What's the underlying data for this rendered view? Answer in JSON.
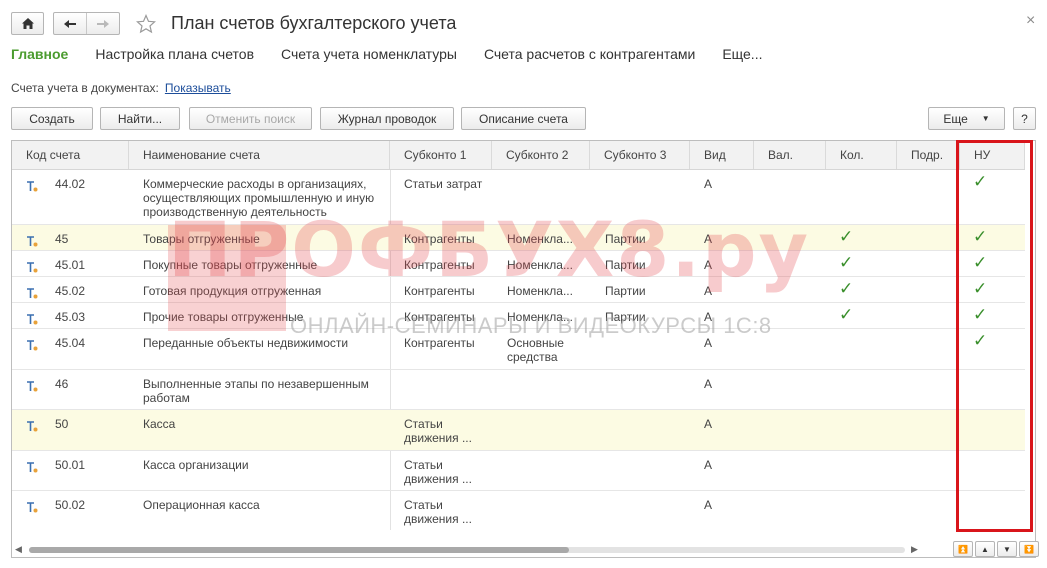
{
  "window": {
    "title": "План счетов бухгалтерского учета",
    "close_glyph": "×",
    "icons": [
      "home-icon",
      "back-arrow-icon",
      "forward-arrow-icon",
      "star-icon"
    ]
  },
  "tabs": [
    {
      "label": "Главное",
      "active": true
    },
    {
      "label": "Настройка плана счетов",
      "active": false
    },
    {
      "label": "Счета учета номенклатуры",
      "active": false
    },
    {
      "label": "Счета расчетов с контрагентами",
      "active": false
    },
    {
      "label": "Еще...",
      "active": false
    }
  ],
  "doc_accounts": {
    "label": "Счета учета в документах:",
    "link": "Показывать"
  },
  "toolbar": {
    "create": "Создать",
    "find": "Найти...",
    "cancel_search": "Отменить поиск",
    "journal": "Журнал проводок",
    "description": "Описание счета",
    "more": "Еще",
    "help": "?"
  },
  "columns": [
    "Код счета",
    "Наименование счета",
    "Субконто 1",
    "Субконто 2",
    "Субконто 3",
    "Вид",
    "Вал.",
    "Кол.",
    "Подр.",
    "НУ"
  ],
  "rows": [
    {
      "code": "44.02",
      "name": "Коммерческие расходы в организациях, осуществляющих промышленную и иную производственную деятельность",
      "s1": "Статьи затрат",
      "s2": "",
      "s3": "",
      "vid": "А",
      "kol": "",
      "nu": "✓"
    },
    {
      "code": "45",
      "name": "Товары отгруженные",
      "s1": "Контрагенты",
      "s2": "Номенкла...",
      "s3": "Партии",
      "vid": "А",
      "kol": "✓",
      "nu": "✓"
    },
    {
      "code": "45.01",
      "name": "Покупные товары отгруженные",
      "s1": "Контрагенты",
      "s2": "Номенкла...",
      "s3": "Партии",
      "vid": "А",
      "kol": "✓",
      "nu": "✓"
    },
    {
      "code": "45.02",
      "name": "Готовая продукция отгруженная",
      "s1": "Контрагенты",
      "s2": "Номенкла...",
      "s3": "Партии",
      "vid": "А",
      "kol": "✓",
      "nu": "✓"
    },
    {
      "code": "45.03",
      "name": "Прочие товары отгруженные",
      "s1": "Контрагенты",
      "s2": "Номенкла...",
      "s3": "Партии",
      "vid": "А",
      "kol": "✓",
      "nu": "✓"
    },
    {
      "code": "45.04",
      "name": "Переданные объекты недвижимости",
      "s1": "Контрагенты",
      "s2": "Основные средства",
      "s3": "",
      "vid": "А",
      "kol": "",
      "nu": "✓"
    },
    {
      "code": "46",
      "name": "Выполненные этапы по незавершенным работам",
      "s1": "",
      "s2": "",
      "s3": "",
      "vid": "А",
      "kol": "",
      "nu": ""
    },
    {
      "code": "50",
      "name": "Касса",
      "s1": "Статьи движения ...",
      "s2": "",
      "s3": "",
      "vid": "А",
      "kol": "",
      "nu": ""
    },
    {
      "code": "50.01",
      "name": "Касса организации",
      "s1": "Статьи движения ...",
      "s2": "",
      "s3": "",
      "vid": "А",
      "kol": "",
      "nu": ""
    },
    {
      "code": "50.02",
      "name": "Операционная касса",
      "s1": "Статьи движения ...",
      "s2": "",
      "s3": "",
      "vid": "А",
      "kol": "",
      "nu": ""
    }
  ],
  "watermark": {
    "main": "ПРОФБУХ8.ру",
    "sub": "ОНЛАЙН-СЕМИНАРЫ И ВИДЕОКУРСЫ 1С:8"
  },
  "colors": {
    "active_tab": "#4b9c2f",
    "link": "#1c4d9a",
    "check": "#3a8f2c",
    "highlight_row": "#fcfbe3",
    "red_box": "#d9151b",
    "watermark": "#e4464b"
  }
}
